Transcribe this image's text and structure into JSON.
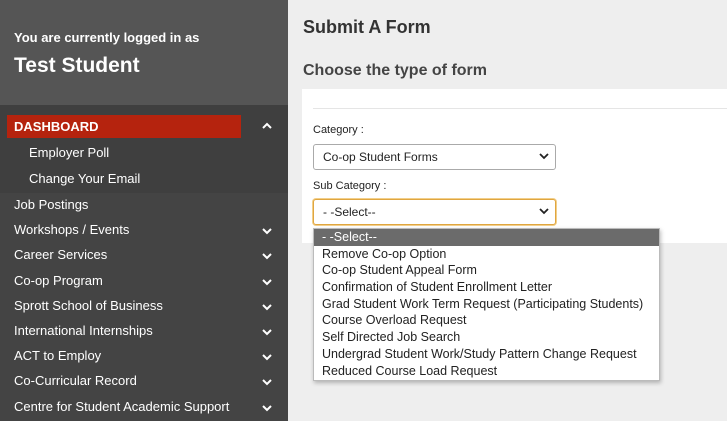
{
  "user": {
    "logged_in_label": "You are currently logged in as",
    "name": "Test Student"
  },
  "nav": {
    "dashboard": "DASHBOARD",
    "dashboard_children": [
      "Employer Poll",
      "Change Your Email"
    ],
    "items": [
      "Job Postings",
      "Workshops / Events",
      "Career Services",
      "Co-op Program",
      "Sprott School of Business",
      "International Internships",
      "ACT to Employ",
      "Co-Curricular Record",
      "Centre for Student Academic Support"
    ]
  },
  "main": {
    "title": "Submit A Form",
    "subtitle": "Choose the type of form",
    "category_label": "Category :",
    "category_value": "Co-op Student Forms",
    "subcategory_label": "Sub Category :",
    "subcategory_value": "- -Select--"
  },
  "dropdown": {
    "options": [
      "- -Select--",
      "Remove Co-op Option",
      "Co-op Student Appeal Form",
      "Confirmation of Student Enrollment Letter",
      "Grad Student Work Term Request (Participating Students)",
      "Course Overload Request",
      "Self Directed Job Search",
      "Undergrad Student Work/Study Pattern Change Request",
      "Reduced Course Load Request"
    ],
    "selected_index": 0
  },
  "colors": {
    "accent": "#b5230e",
    "sidebar": "#444444",
    "focus_border": "#e0a640"
  },
  "icons": {
    "expand": "chevron-down-icon",
    "collapse": "chevron-up-icon"
  }
}
